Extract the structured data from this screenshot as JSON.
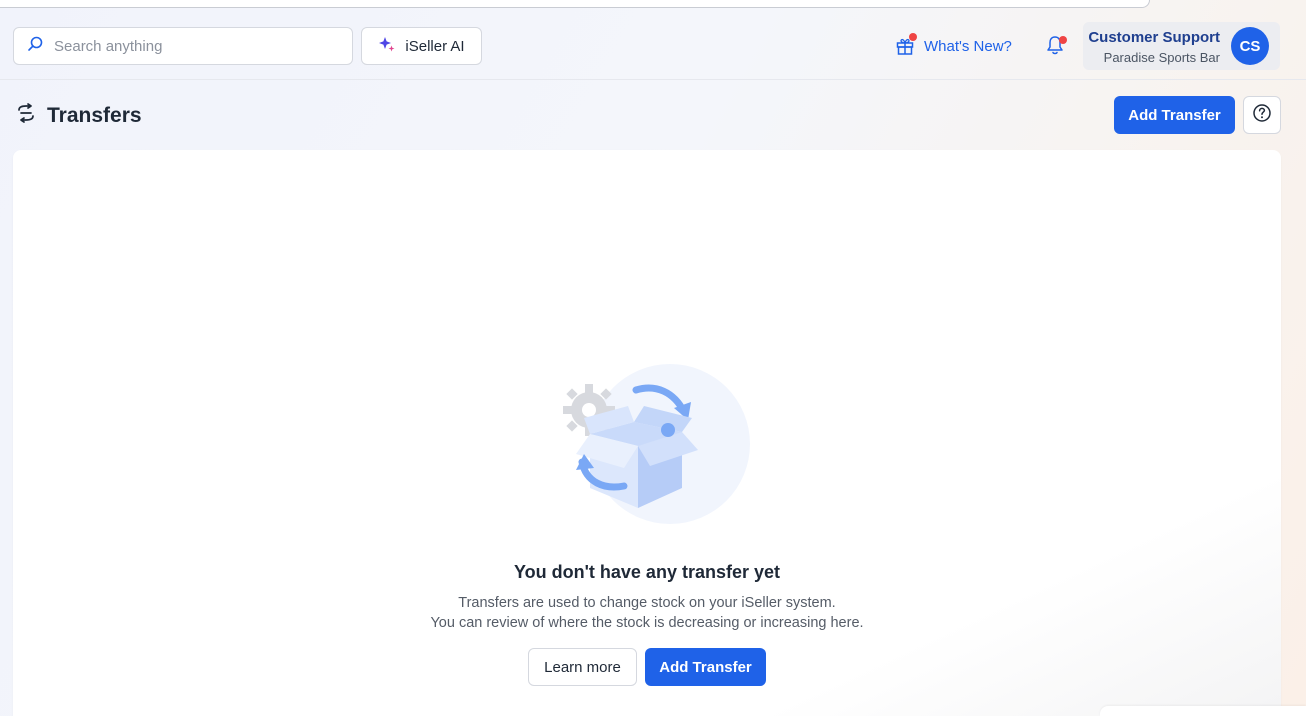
{
  "search": {
    "placeholder": "Search anything"
  },
  "ai_button": {
    "label": "iSeller AI"
  },
  "whats_new": {
    "label": "What's New?"
  },
  "user": {
    "name": "Customer Support",
    "org": "Paradise Sports Bar",
    "initials": "CS"
  },
  "page": {
    "title": "Transfers",
    "add_button": "Add Transfer"
  },
  "empty_state": {
    "title": "You don't have any transfer yet",
    "line1": "Transfers are used to change stock on your iSeller system.",
    "line2": "You can review of where the stock is decreasing or increasing here.",
    "learn_more": "Learn more",
    "add_button": "Add Transfer"
  },
  "colors": {
    "primary": "#1f62e8",
    "notification_dot": "#ef4444"
  },
  "icons": [
    "search-icon",
    "sparkle-icon",
    "gift-icon",
    "bell-icon",
    "transfers-icon",
    "help-icon"
  ]
}
